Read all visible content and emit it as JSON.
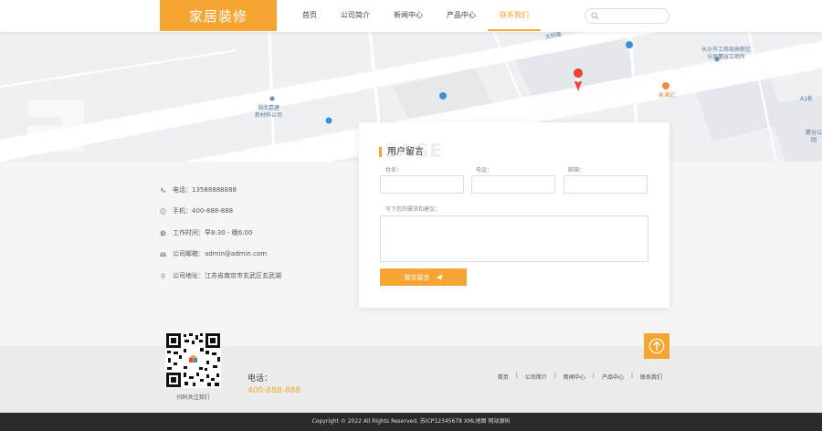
{
  "header": {
    "logo": "家居装修",
    "nav": [
      "首页",
      "公司简介",
      "新闻中心",
      "产品中心",
      "联系我们"
    ],
    "active_index": 4,
    "search_placeholder": ""
  },
  "map": {
    "labels": {
      "road": "文轩路",
      "company_a": "长沙市工商局高新区\n分局麓谷工商所",
      "company_b": "湖南嘉建\n新材料公司",
      "shop": "麦满记",
      "right_edge": "A1栋",
      "right_edge2": "麓谷公\n园"
    }
  },
  "contact": {
    "tel": "电话：13588888888",
    "mobile": "手机：400-888-888",
    "hours": "工作时间：早8:30 - 晚6:00",
    "email": "公司邮箱：admin@admin.com",
    "address": "公司地址：江苏省南京市玄武区玄武湖"
  },
  "message": {
    "title": "用户留言",
    "bg_text": "SAGE",
    "name_label": "姓名：",
    "phone_label": "电话：",
    "email_label": "邮箱：",
    "content_label": "写下您的需求和建议：",
    "submit_label": "提交留言"
  },
  "footer": {
    "qr_caption": "扫码关注我们",
    "phone_label": "电话：",
    "phone_number": "400-888-888",
    "nav": [
      "首页",
      "公司简介",
      "新闻中心",
      "产品中心",
      "联系我们"
    ],
    "copyright": "Copyright © 2022 All Rights Reserved. 苏ICP12345678 XML地图 网站源码"
  },
  "colors": {
    "accent": "#f6a532",
    "footer_bar": "#2b2b2b"
  }
}
